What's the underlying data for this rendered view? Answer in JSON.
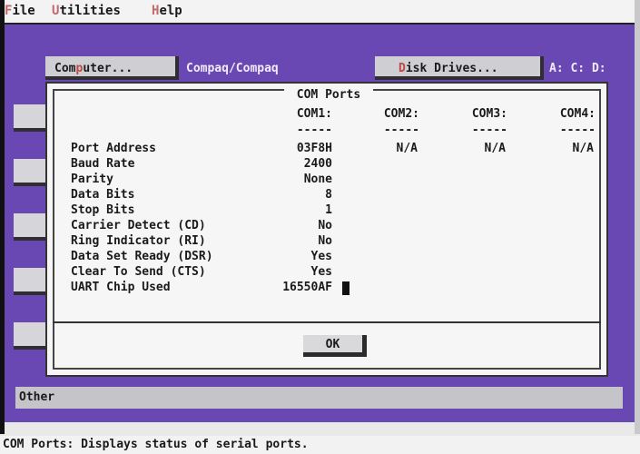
{
  "menu": [
    {
      "hotkey": "F",
      "rest": "ile"
    },
    {
      "hotkey": "U",
      "rest": "tilities"
    },
    {
      "hotkey": "H",
      "rest": "elp"
    }
  ],
  "desktop": {
    "computer_button": {
      "pre": "Com",
      "hotkey": "p",
      "post": "uter..."
    },
    "computer_value": "Compaq/Compaq",
    "disk_button": {
      "pre": "",
      "hotkey": "D",
      "post": "isk Drives..."
    },
    "disk_value": "A: C: D:",
    "other_label": "Other"
  },
  "dialog": {
    "title": "COM Ports",
    "columns": [
      "COM1:",
      "COM2:",
      "COM3:",
      "COM4:"
    ],
    "dashes": "-----",
    "rows": [
      {
        "label": "Port Address",
        "com1": "03F8H",
        "com2": "N/A",
        "com3": "N/A",
        "com4": "N/A"
      },
      {
        "label": "Baud Rate",
        "com1": "2400"
      },
      {
        "label": "Parity",
        "com1": "None"
      },
      {
        "label": "Data Bits",
        "com1": "8"
      },
      {
        "label": "Stop Bits",
        "com1": "1"
      },
      {
        "label": "Carrier Detect (CD)",
        "com1": "No"
      },
      {
        "label": "Ring Indicator (RI)",
        "com1": "No"
      },
      {
        "label": "Data Set Ready (DSR)",
        "com1": "Yes"
      },
      {
        "label": "Clear To Send (CTS)",
        "com1": "Yes"
      },
      {
        "label": "UART Chip Used",
        "com1": "16550AF"
      }
    ],
    "ok_label": "OK"
  },
  "status": "COM Ports: Displays status of serial ports.",
  "colors": {
    "desktop": "#6a48b4",
    "hotkey": "#c04848"
  }
}
